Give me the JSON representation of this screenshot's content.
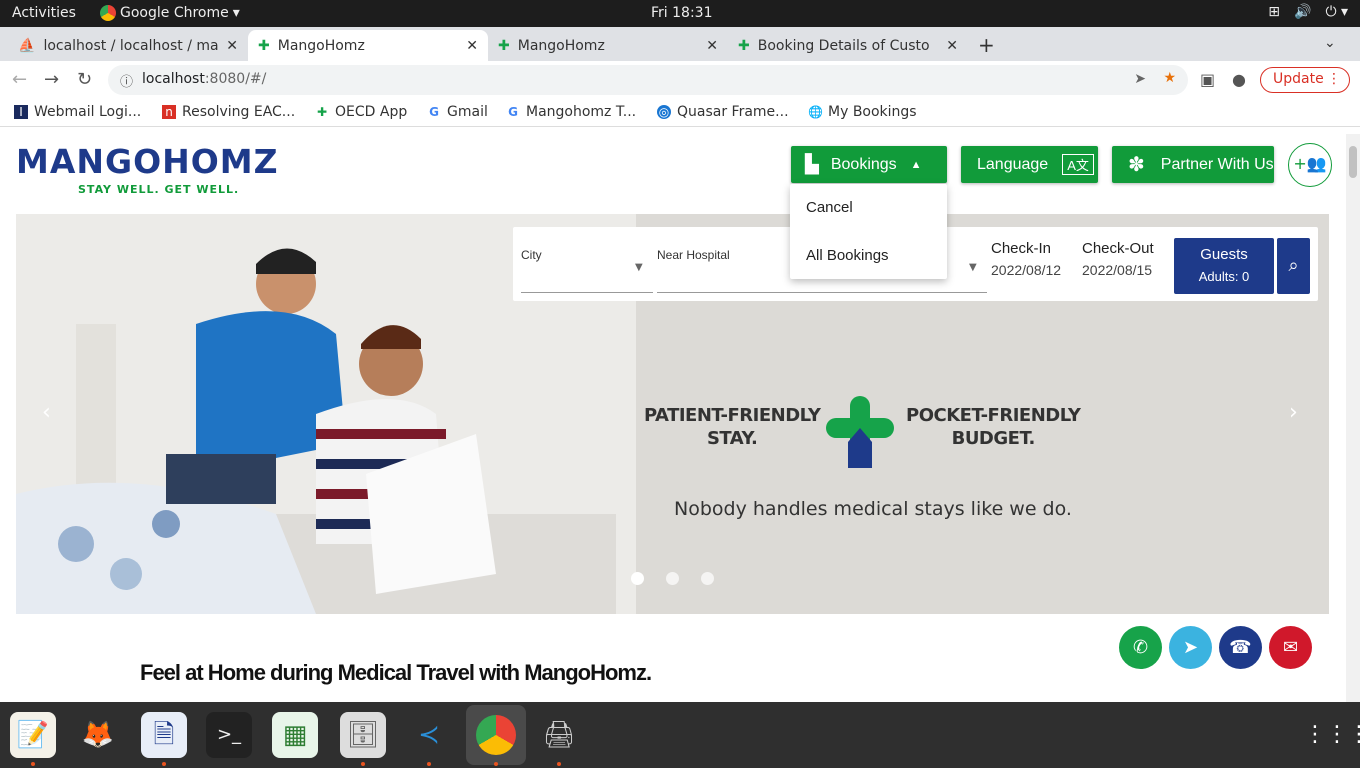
{
  "system_bar": {
    "activities": "Activities",
    "app_name": "Google Chrome",
    "clock": "Fri 18:31"
  },
  "tabs": [
    {
      "title": "localhost / localhost / mar"
    },
    {
      "title": "MangoHomz"
    },
    {
      "title": "MangoHomz"
    },
    {
      "title": "Booking Details of Custo"
    }
  ],
  "toolbar": {
    "url_host": "localhost",
    "url_path": ":8080/#/",
    "update_label": "Update"
  },
  "bookmarks": [
    {
      "label": "Webmail Logi..."
    },
    {
      "label": "Resolving EAC..."
    },
    {
      "label": "OECD App"
    },
    {
      "label": "Gmail"
    },
    {
      "label": "Mangohomz T..."
    },
    {
      "label": "Quasar Frame..."
    },
    {
      "label": "My Bookings"
    }
  ],
  "header": {
    "logo_text": "MANGOHOMZ",
    "logo_tagline": "STAY WELL. GET WELL.",
    "bookings_label": "Bookings",
    "language_label": "Language",
    "partner_label": "Partner With Us"
  },
  "bookings_menu": [
    {
      "label": "Cancel"
    },
    {
      "label": "All Bookings"
    }
  ],
  "search": {
    "city_label": "City",
    "hospital_label": "Near Hospital",
    "checkin_label": "Check-In",
    "checkin_value": "2022/08/12",
    "checkout_label": "Check-Out",
    "checkout_value": "2022/08/15",
    "guests_label": "Guests",
    "guests_value": "Adults: 0"
  },
  "banner": {
    "left_line1": "PATIENT-FRIENDLY",
    "left_line2": "STAY.",
    "right_line1": "POCKET-FRIENDLY",
    "right_line2": "BUDGET.",
    "tagline": "Nobody handles medical stays like we do."
  },
  "headline": "Feel at Home during Medical Travel with MangoHomz.",
  "colors": {
    "brand_green": "#119b3a",
    "brand_navy": "#1e3a8a",
    "email_red": "#d0182b",
    "whatsapp": "#17a34a",
    "telegram": "#3bb3e0"
  }
}
